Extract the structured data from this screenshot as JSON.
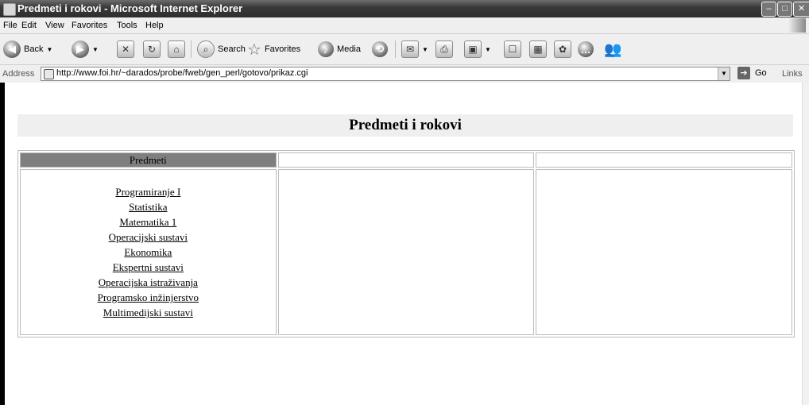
{
  "window": {
    "title": "Predmeti i rokovi - Microsoft Internet Explorer",
    "buttons": [
      "–",
      "□",
      "✕"
    ]
  },
  "menu": [
    {
      "label": "File"
    },
    {
      "label": "Edit"
    },
    {
      "label": "View"
    },
    {
      "label": "Favorites"
    },
    {
      "label": "Tools"
    },
    {
      "label": "Help"
    }
  ],
  "toolbar": {
    "back_label": "Back",
    "search_label": "Search",
    "favorites_label": "Favorites",
    "media_label": "Media"
  },
  "address": {
    "label": "Address",
    "url": "http://www.foi.hr/~darados/probe/fweb/gen_perl/gotovo/prikaz.cgi",
    "go_label": "Go",
    "links_label": "Links"
  },
  "page": {
    "heading": "Predmeti i rokovi",
    "table": {
      "headers": [
        "Predmeti",
        "",
        ""
      ],
      "courses": [
        "Programiranje I",
        "Statistika",
        "Matematika 1",
        "Operacijski sustavi",
        "Ekonomika",
        "Ekspertni sustavi",
        "Operacijska istraživanja",
        "Programsko inžinjerstvo",
        "Multimedijski sustavi"
      ]
    }
  }
}
